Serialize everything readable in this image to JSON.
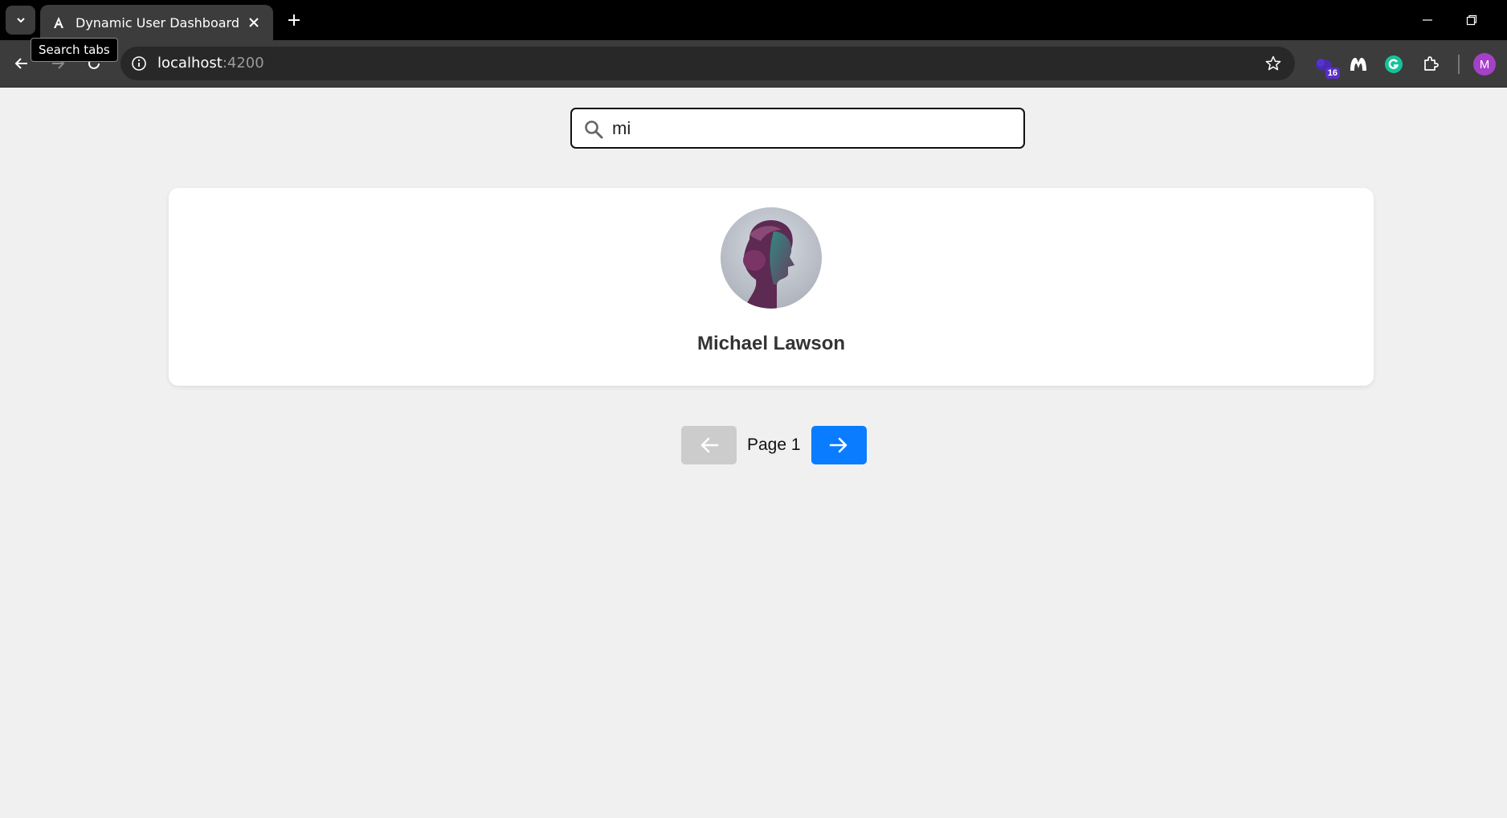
{
  "browser": {
    "tab_title": "Dynamic User Dashboard",
    "tooltip": "Search tabs",
    "url_host": "localhost",
    "url_port": ":4200",
    "extension_badge": "16",
    "profile_initial": "M"
  },
  "search": {
    "value": "mi",
    "placeholder": ""
  },
  "users": [
    {
      "name": "Michael Lawson"
    }
  ],
  "pagination": {
    "label": "Page 1"
  },
  "colors": {
    "page_bg": "#f0f0f0",
    "next_button": "#0a7cff",
    "prev_button_disabled": "#cccccc",
    "profile": "#a640c9"
  }
}
